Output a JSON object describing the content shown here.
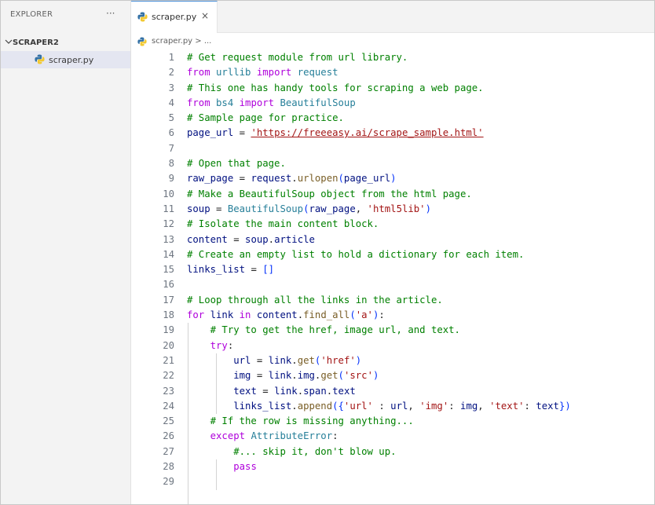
{
  "explorer": {
    "title": "EXPLORER",
    "more": "···"
  },
  "folder": {
    "name": "SCRAPER2"
  },
  "file": {
    "name": "scraper.py"
  },
  "tab": {
    "label": "scraper.py",
    "close": "×"
  },
  "breadcrumb": {
    "text": "scraper.py > ..."
  },
  "code_lines": [
    {
      "n": "1",
      "text": "# Get request module from url library."
    },
    {
      "n": "2",
      "text": "from urllib import request"
    },
    {
      "n": "3",
      "text": "# This one has handy tools for scraping a web page."
    },
    {
      "n": "4",
      "text": "from bs4 import BeautifulSoup"
    },
    {
      "n": "5",
      "text": "# Sample page for practice."
    },
    {
      "n": "6",
      "text": "page_url = 'https://freeeasy.ai/scrape_sample.html'"
    },
    {
      "n": "7",
      "text": ""
    },
    {
      "n": "8",
      "text": "# Open that page."
    },
    {
      "n": "9",
      "text": "raw_page = request.urlopen(page_url)"
    },
    {
      "n": "10",
      "text": "# Make a BeautifulSoup object from the html page."
    },
    {
      "n": "11",
      "text": "soup = BeautifulSoup(raw_page, 'html5lib')"
    },
    {
      "n": "12",
      "text": "# Isolate the main content block."
    },
    {
      "n": "13",
      "text": "content = soup.article"
    },
    {
      "n": "14",
      "text": "# Create an empty list to hold a dictionary for each item."
    },
    {
      "n": "15",
      "text": "links_list = []"
    },
    {
      "n": "16",
      "text": ""
    },
    {
      "n": "17",
      "text": "# Loop through all the links in the article."
    },
    {
      "n": "18",
      "text": "for link in content.find_all('a'):"
    },
    {
      "n": "19",
      "text": "    # Try to get the href, image url, and text."
    },
    {
      "n": "20",
      "text": "    try:"
    },
    {
      "n": "21",
      "text": "        url = link.get('href')"
    },
    {
      "n": "22",
      "text": "        img = link.img.get('src')"
    },
    {
      "n": "23",
      "text": "        text = link.span.text"
    },
    {
      "n": "24",
      "text": "        links_list.append({'url' : url, 'img': img, 'text': text})"
    },
    {
      "n": "25",
      "text": "    # If the row is missing anything..."
    },
    {
      "n": "26",
      "text": "    except AttributeError:"
    },
    {
      "n": "27",
      "text": "        #... skip it, don't blow up."
    },
    {
      "n": "28",
      "text": "        pass"
    },
    {
      "n": "29",
      "text": ""
    }
  ]
}
